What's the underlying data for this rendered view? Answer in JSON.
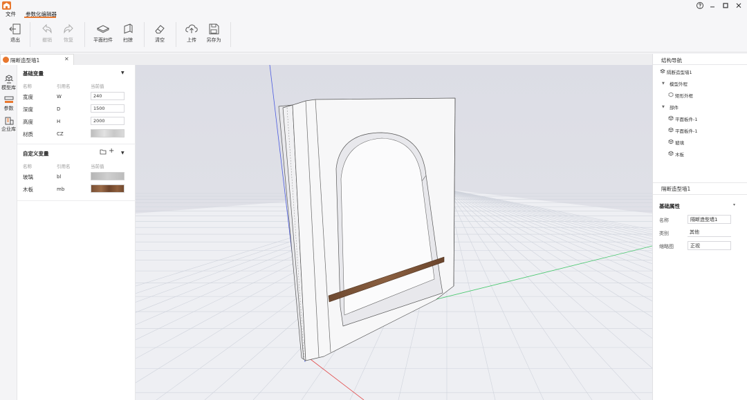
{
  "menu": {
    "file": "文件",
    "param_editor": "参数化编辑器"
  },
  "toolbar": {
    "exit": "退出",
    "undo": "撤销",
    "redo": "恢复",
    "plane_sweep": "平面扫件",
    "sweep": "扫掠",
    "clear": "清空",
    "upload": "上传",
    "save_as": "另存为"
  },
  "doc_tab": {
    "title": "隔断造型墙1"
  },
  "rail": {
    "model_lib": "模型库",
    "params": "参数",
    "enterprise_lib": "企业库"
  },
  "basic_vars": {
    "title": "基础变量",
    "columns": {
      "name": "名称",
      "ref": "引用名",
      "current": "当前值"
    },
    "rows": [
      {
        "name": "宽度",
        "ref": "W",
        "value": "240"
      },
      {
        "name": "深度",
        "ref": "D",
        "value": "1500"
      },
      {
        "name": "高度",
        "ref": "H",
        "value": "2000"
      },
      {
        "name": "材质",
        "ref": "CZ",
        "value": ""
      }
    ]
  },
  "custom_vars": {
    "title": "自定义变量",
    "columns": {
      "name": "名称",
      "ref": "引用名",
      "current": "当前值"
    },
    "rows": [
      {
        "name": "玻璃",
        "ref": "bl"
      },
      {
        "name": "木板",
        "ref": "mb"
      }
    ]
  },
  "nav": {
    "title": "结构导航",
    "root": "隔断造型墙1",
    "group1": "模型外程",
    "group1_children": [
      "矩形外框"
    ],
    "group2": "部件",
    "group2_children": [
      "平面板件-1",
      "平面板件-1",
      "玻璃",
      "木板"
    ]
  },
  "props": {
    "title": "隔断造型墙1",
    "section": "基础属性",
    "name_label": "名称",
    "name_value": "隔断造型墙1",
    "category_label": "类别",
    "category_value": "其他",
    "thumb_label": "缩略图",
    "thumb_value": "正视"
  },
  "colors": {
    "accent": "#e8772e"
  }
}
